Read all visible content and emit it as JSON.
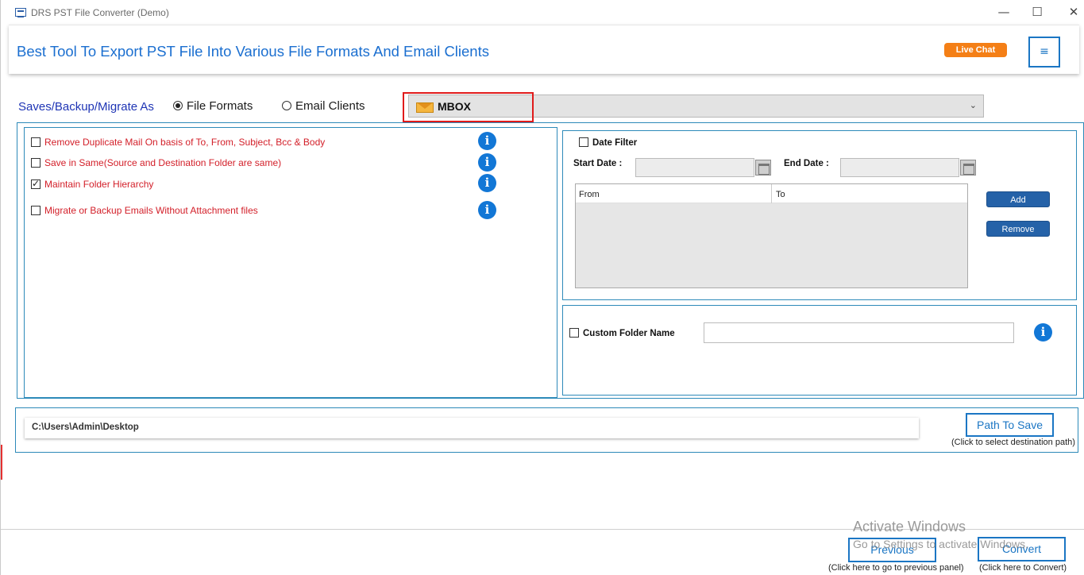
{
  "window": {
    "title": "DRS PST File Converter (Demo)",
    "minimize": "—",
    "maximize": "☐",
    "close": "✕"
  },
  "header": {
    "headline": "Best Tool To Export PST File Into Various File Formats And Email Clients",
    "live_chat": "Live Chat",
    "menu_icon": "≡"
  },
  "save_as": {
    "label": "Saves/Backup/Migrate As",
    "option_file_formats": "File Formats",
    "option_email_clients": "Email Clients",
    "selected": "File Formats",
    "format_value": "MBOX",
    "format_icon": "envelope-icon",
    "dropdown_icon": "chevron-down-icon"
  },
  "options": [
    {
      "label": "Remove Duplicate Mail On basis of To, From, Subject, Bcc & Body",
      "checked": false
    },
    {
      "label": "Save in Same(Source and Destination Folder are same)",
      "checked": false
    },
    {
      "label": "Maintain Folder Hierarchy",
      "checked": true
    },
    {
      "label": "Migrate or Backup Emails Without Attachment files",
      "checked": false
    }
  ],
  "info_glyph": "i",
  "date_filter": {
    "label": "Date Filter",
    "checked": false,
    "start_label": "Start Date :",
    "end_label": "End Date :",
    "start_value": "",
    "end_value": "",
    "table_headers": [
      "From",
      "To"
    ],
    "add_button": "Add",
    "remove_button": "Remove"
  },
  "custom_folder": {
    "label": "Custom Folder Name",
    "checked": false,
    "value": ""
  },
  "path": {
    "value": "C:\\Users\\Admin\\Desktop",
    "button": "Path To Save",
    "hint": "(Click to select destination path)"
  },
  "footer": {
    "previous_button": "Previous",
    "previous_hint": "(Click here to go to previous panel)",
    "convert_button": "Convert",
    "convert_hint": "(Click here to Convert)"
  },
  "watermark": {
    "line1": "Activate Windows",
    "line2": "Go to Settings to activate Windows."
  },
  "colors": {
    "accent": "#1b76c4",
    "headline": "#1b6fd0",
    "live_chat": "#f47f16",
    "option_text": "#d3202a",
    "highlight": "#e01b1b"
  }
}
